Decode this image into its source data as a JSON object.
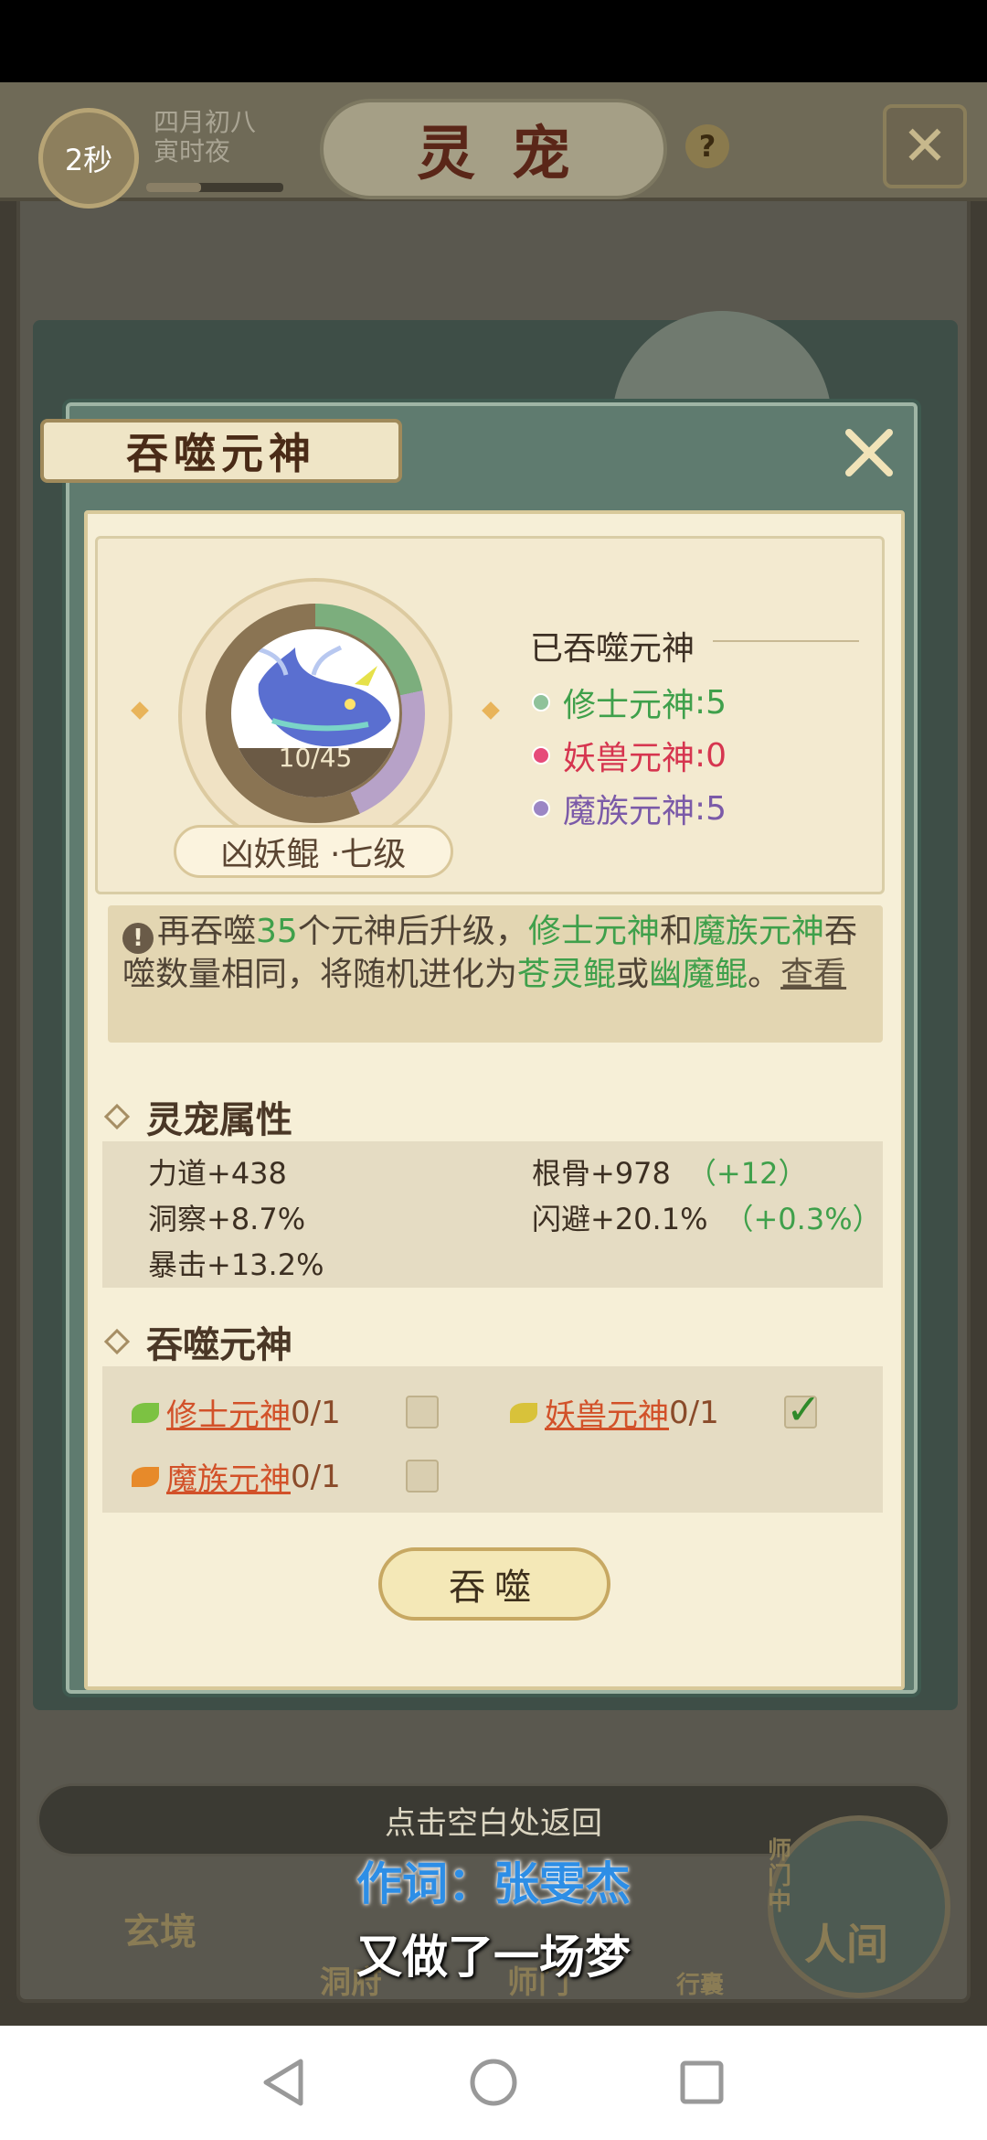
{
  "hud": {
    "timer": "2秒",
    "date_line1": "四月初八",
    "date_line2": "寅时夜",
    "title": "灵宠",
    "help": "?"
  },
  "dialog": {
    "title": "吞噬元神",
    "pet": {
      "name": "凶妖鲲 ·七级",
      "progress_text": "10/45",
      "progress_fraction": 0.222
    },
    "eaten": {
      "title": "已吞噬元神",
      "items": [
        {
          "label": "修士元神",
          "value": ":5",
          "color": "#3fa04b"
        },
        {
          "label": "妖兽元神",
          "value": ":0",
          "color": "#d6354f"
        },
        {
          "label": "魔族元神",
          "value": ":5",
          "color": "#7b5aa8"
        }
      ]
    },
    "info": {
      "part1": "再吞噬",
      "count": "35",
      "part2": "个元神后升级，",
      "soul_a": "修士元神",
      "part3": "和",
      "soul_b": "魔族元神",
      "part4": "吞噬数量相同，将随机进化为",
      "evo_a": "苍灵鲲",
      "part5": "或",
      "evo_b": "幽魔鲲",
      "part6": "。",
      "view_link": "查看"
    },
    "attributes": {
      "heading": "灵宠属性",
      "items": [
        {
          "label": "力道+438",
          "bonus": ""
        },
        {
          "label": "根骨+978",
          "bonus": "（+12）"
        },
        {
          "label": "洞察+8.7%",
          "bonus": ""
        },
        {
          "label": "闪避+20.1%",
          "bonus": "（+0.3%）"
        },
        {
          "label": "暴击+13.2%",
          "bonus": ""
        }
      ]
    },
    "devour": {
      "heading": "吞噬元神",
      "souls": [
        {
          "label": "修士元神",
          "count": "0/1",
          "checked": false,
          "leaf_color": "#7cc242"
        },
        {
          "label": "妖兽元神",
          "count": "0/1",
          "checked": true,
          "leaf_color": "#d8c23a"
        },
        {
          "label": "魔族元神",
          "count": "0/1",
          "checked": false,
          "leaf_color": "#e78a2a"
        }
      ],
      "button": "吞噬"
    }
  },
  "background": {
    "return_hint": "点击空白处返回",
    "nav": [
      "玄境",
      "洞府",
      "师门",
      "行囊",
      "人间"
    ],
    "nav_badge": "师门中"
  },
  "lyrics": {
    "line1": "作词：张雯杰",
    "line2": "又做了一场梦"
  }
}
